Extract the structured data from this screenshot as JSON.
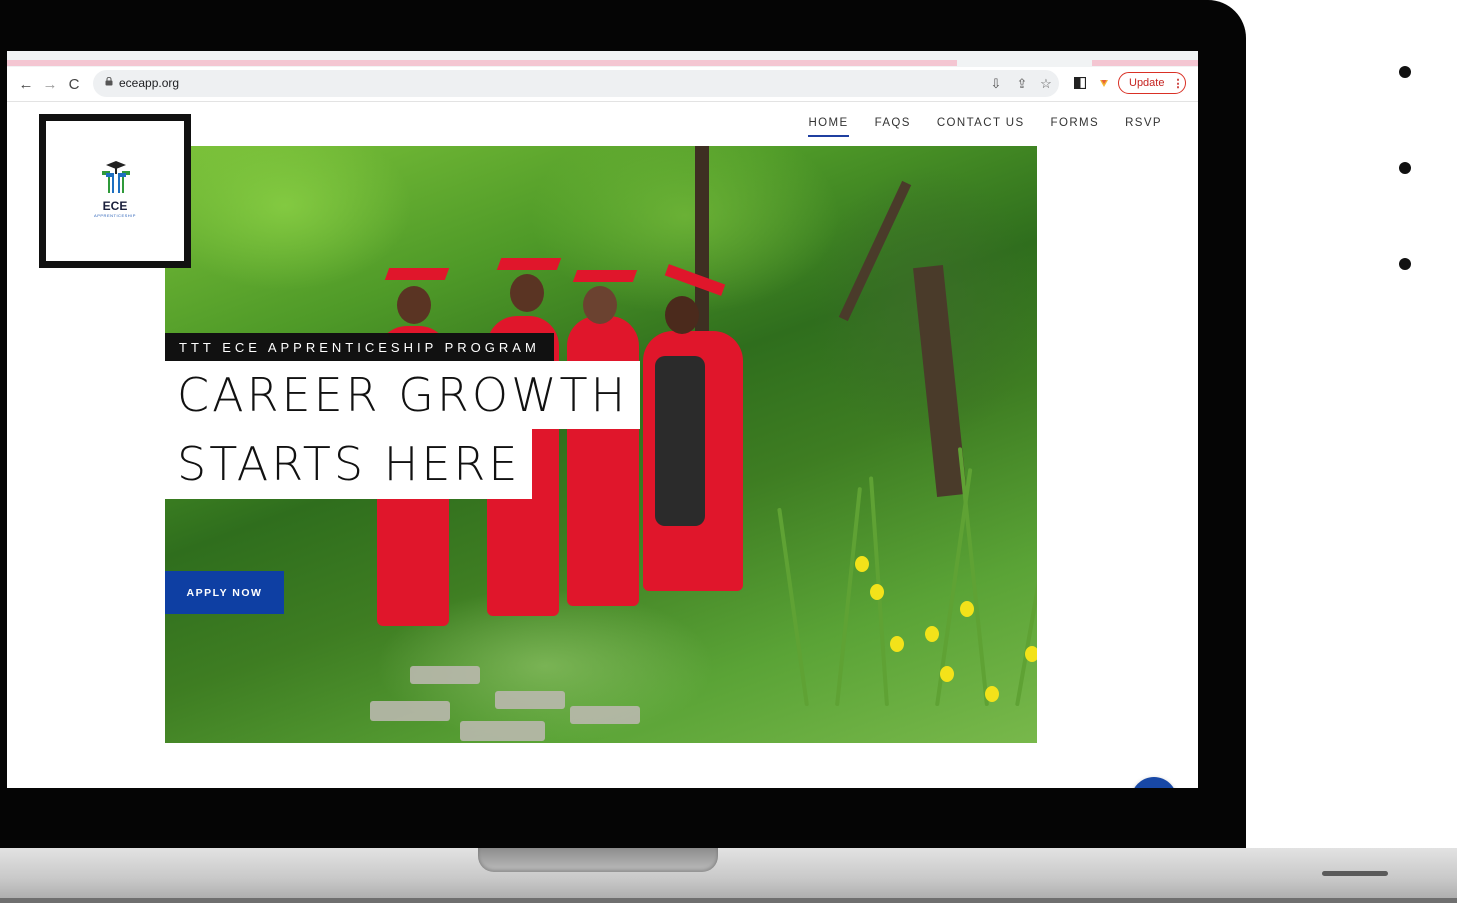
{
  "browser": {
    "url": "eceapp.org",
    "update_label": "Update",
    "update_menu": "⋮"
  },
  "site": {
    "logo_text": "ECE",
    "logo_subtext": "APPRENTICESHIP",
    "nav": [
      "HOME",
      "FAQS",
      "CONTACT US",
      "FORMS",
      "RSVP"
    ],
    "active_nav": "HOME"
  },
  "hero": {
    "eyebrow": "TTT ECE APPRENTICESHIP PROGRAM",
    "headline_line1": "CAREER GROWTH",
    "headline_line2": "STARTS HERE",
    "cta": "APPLY NOW"
  },
  "colors": {
    "brand_blue": "#0e3fa3",
    "update_red": "#d93025",
    "nav_underline": "#1f3fa0"
  },
  "icons": {
    "back": "arrow-left",
    "forward": "arrow-right",
    "reload": "reload",
    "lock": "lock",
    "install": "install",
    "share": "share",
    "bookmark": "star",
    "sidepanel": "side-panel",
    "extension": "extension",
    "chat": "chat-bubble"
  }
}
